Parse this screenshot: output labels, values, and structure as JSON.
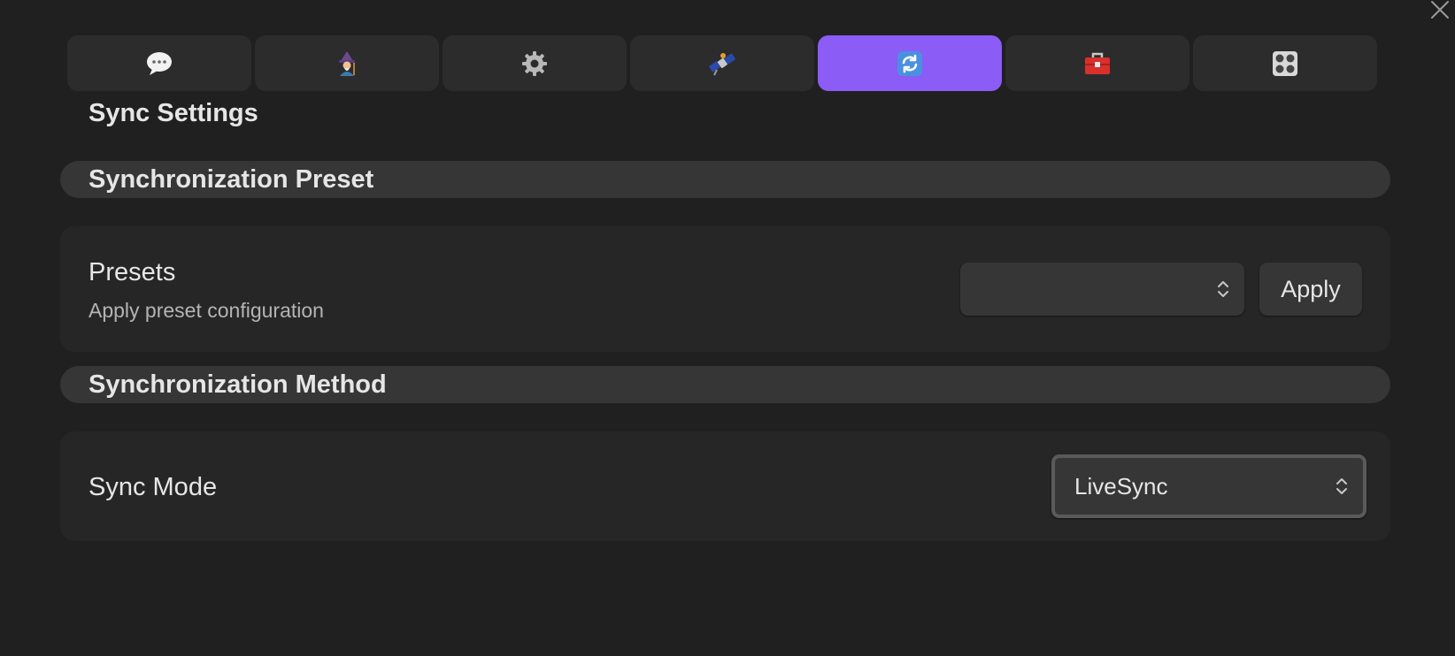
{
  "tabs": [
    {
      "icon": "speech-bubble-icon",
      "active": false
    },
    {
      "icon": "wizard-icon",
      "active": false
    },
    {
      "icon": "gear-icon",
      "active": false
    },
    {
      "icon": "satellite-icon",
      "active": false
    },
    {
      "icon": "sync-arrows-icon",
      "active": true
    },
    {
      "icon": "toolbox-icon",
      "active": false
    },
    {
      "icon": "control-knobs-icon",
      "active": false
    }
  ],
  "page": {
    "title": "Sync Settings"
  },
  "sections": {
    "preset": {
      "title": "Synchronization Preset",
      "setting_name": "Presets",
      "setting_desc": "Apply preset configuration",
      "select_value": "",
      "apply_label": "Apply"
    },
    "method": {
      "title": "Synchronization Method",
      "setting_name": "Sync Mode",
      "select_value": "LiveSync"
    }
  },
  "colors": {
    "background": "#202020",
    "accent": "#8b5cf6",
    "tab": "#2c2c2c",
    "card": "#262626",
    "header": "#363636"
  }
}
